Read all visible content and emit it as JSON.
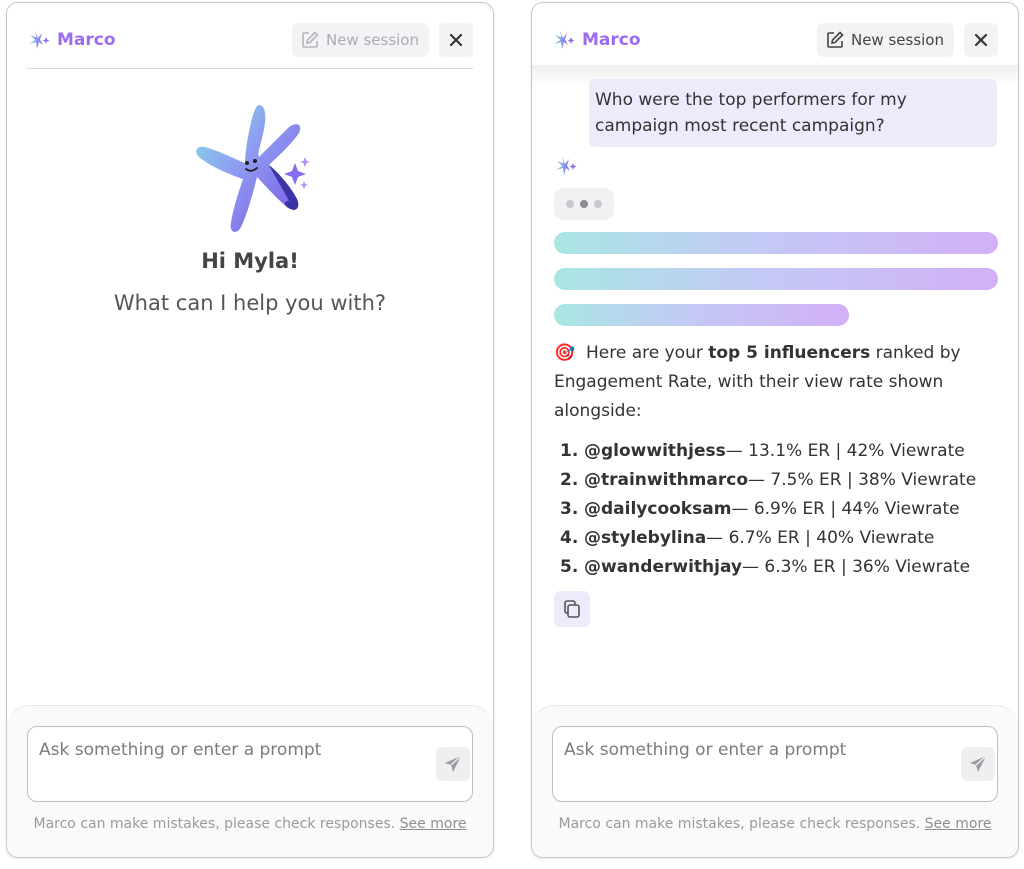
{
  "app": {
    "brand": "Marco",
    "new_session_label": "New session",
    "accent_color": "#9b6cf0"
  },
  "welcome": {
    "greeting": "Hi Myla!",
    "subtitle": "What can I help you with?"
  },
  "composer": {
    "placeholder": "Ask something or enter a prompt",
    "disclaimer": "Marco can make mistakes, please check responses.",
    "see_more": "See more"
  },
  "chat": {
    "user_message": "Who were the top performers for my campaign most recent campaign?",
    "answer": {
      "emoji": "🎯",
      "prefix": "Here are your ",
      "bold": "top 5 influencers",
      "suffix": " ranked by Engagement Rate, with their view rate shown alongside:"
    },
    "rankings": [
      {
        "num": "1.",
        "handle": "@glowwithjess",
        "stats": " — 13.1% ER | 42% Viewrate"
      },
      {
        "num": "2.",
        "handle": "@trainwithmarco",
        "stats": " — 7.5% ER | 38% Viewrate"
      },
      {
        "num": "3.",
        "handle": "@dailycooksam",
        "stats": " — 6.9% ER | 44% Viewrate"
      },
      {
        "num": "4.",
        "handle": "@stylebylina",
        "stats": " — 6.7% ER | 40% Viewrate"
      },
      {
        "num": "5.",
        "handle": "@wanderwithjay",
        "stats": " — 6.3% ER | 36% Viewrate"
      }
    ]
  },
  "icons": {
    "brand": "sparkle-star-icon",
    "new_session": "edit-icon",
    "close": "close-icon",
    "send": "send-icon",
    "copy": "copy-icon",
    "mascot": "starfish-mascot-icon"
  }
}
